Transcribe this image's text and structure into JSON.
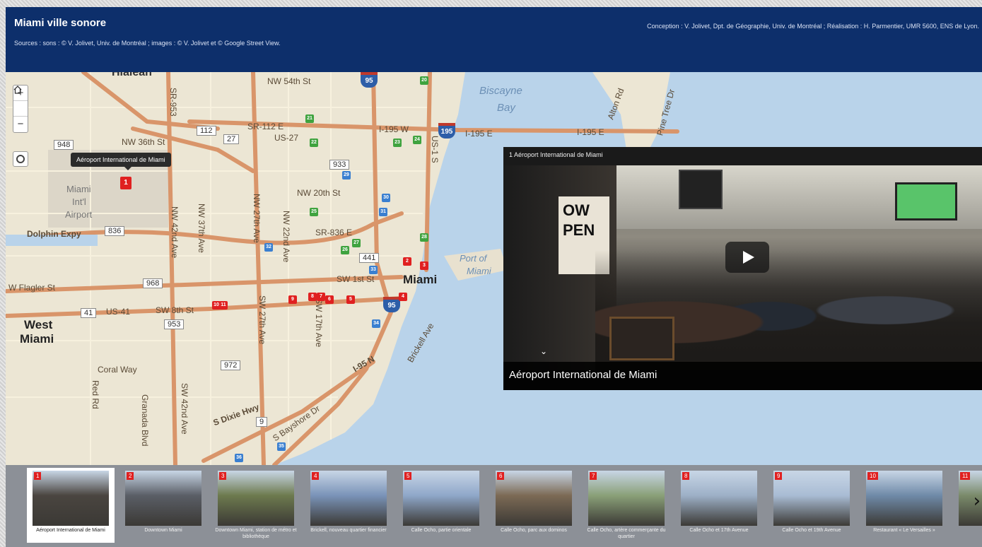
{
  "header": {
    "title": "Miami ville sonore",
    "sources": "Sources : sons : © V. Jolivet, Univ. de Montréal ; images : © V. Jolivet et © Google Street View.",
    "credits": "Conception : V. Jolivet, Dpt. de Géographie, Univ. de Montréal ; Réalisation : H. Parmentier, UMR 5600, ENS de Lyon."
  },
  "map": {
    "controls": {
      "zoom_in": "+",
      "zoom_out": "−",
      "home_icon": "home-icon",
      "locate_icon": "locate-icon"
    },
    "tooltip": "Aéroport International de Miami",
    "labels": {
      "hialeah": "Hialeah",
      "biscayne": "Biscayne",
      "bay": "Bay",
      "airport_1": "Miami",
      "airport_2": "Int'l",
      "airport_3": "Airport",
      "dolphin": "Dolphin Expy",
      "port_1": "Port of",
      "port_2": "Miami",
      "miami": "Miami",
      "west_1": "West",
      "west_2": "Miami",
      "flagler": "W Flagler St",
      "us41": "US-41",
      "sw8": "SW 8th St",
      "coral": "Coral Way",
      "nw54": "NW 54th St",
      "nw36": "NW 36th St",
      "nw20": "NW 20th St",
      "sr112": "SR-112 E",
      "us27": "US-27",
      "i195w": "I-195 W",
      "i195e": "I-195 E",
      "i195e2": "I-195 E",
      "sr836": "SR-836 E",
      "sw1": "SW 1st St",
      "s_dixie": "S Dixie Hwy",
      "s_bayshore": "S Bayshore Dr",
      "brickell": "Brickell Ave",
      "i95n": "I-95 N",
      "nw42": "NW 42nd Ave",
      "nw37": "NW 37th Ave",
      "nw27": "NW 27th Ave",
      "nw22": "NW 22nd Ave",
      "sw27": "SW 27th Ave",
      "sw17": "SW 17th Ave",
      "sw42": "SW 42nd Ave",
      "red_rd": "Red Rd",
      "granada": "Granada Blvd",
      "sr953": "SR-953",
      "alton": "Alton Rd",
      "pine": "Pine Tree Dr",
      "us1": "US-1 S"
    },
    "shields": [
      "948",
      "112",
      "27",
      "933",
      "836",
      "968",
      "41",
      "953",
      "972",
      "9",
      "441"
    ],
    "interstate": [
      "95",
      "195",
      "95"
    ],
    "markers": {
      "red": [
        "1",
        "2",
        "3",
        "4",
        "5",
        "6",
        "7",
        "8",
        "9",
        "10",
        "11"
      ],
      "green": [
        "20",
        "21",
        "22",
        "23",
        "24",
        "25",
        "26",
        "27",
        "28"
      ],
      "blue": [
        "29",
        "30",
        "31",
        "32",
        "33",
        "34",
        "35",
        "36"
      ]
    }
  },
  "video": {
    "title": "1 Aéroport International de Miami",
    "caption": "Aéroport International de Miami",
    "play_icon": "play-icon",
    "collapse_icon": "chevron-down-icon",
    "sign_text": "OW PEN"
  },
  "strip": {
    "next_icon": "chevron-right-icon",
    "items": [
      {
        "num": "1",
        "caption": "Aéroport International de Miami",
        "active": true,
        "color": "#4a4540"
      },
      {
        "num": "2",
        "caption": "Downtown Miami",
        "color": "#5a5e66"
      },
      {
        "num": "3",
        "caption": "Downtown Miami, station de métro et bibliothèque",
        "color": "#6d7a4e"
      },
      {
        "num": "4",
        "caption": "Brickell, nouveau quartier financier",
        "color": "#7a93b8"
      },
      {
        "num": "5",
        "caption": "Calle Ocho, partie orientale",
        "color": "#8fa7c9"
      },
      {
        "num": "6",
        "caption": "Calle Ocho, parc aux dominos",
        "color": "#7c6a55"
      },
      {
        "num": "7",
        "caption": "Calle Ocho, artère commerçante du quartier",
        "color": "#8aa078"
      },
      {
        "num": "8",
        "caption": "Calle Ocho et 17th Avenue",
        "color": "#9db0c7"
      },
      {
        "num": "9",
        "caption": "Calle Ocho et 19th Avenue",
        "color": "#a9bcd4"
      },
      {
        "num": "10",
        "caption": "Restaurant « Le Versailles »",
        "color": "#6f8aa8"
      },
      {
        "num": "11",
        "caption": "Rest",
        "color": "#7a8a6a"
      }
    ]
  }
}
